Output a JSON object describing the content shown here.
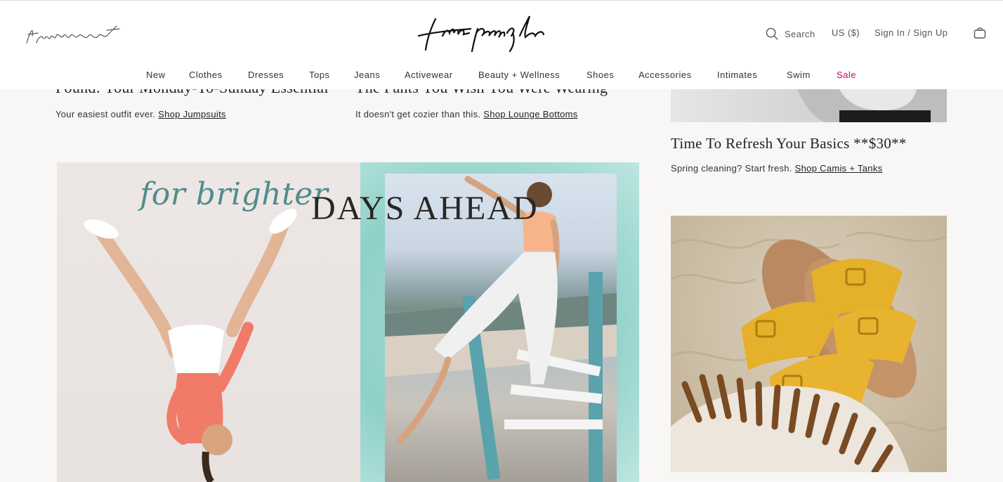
{
  "header": {
    "secondary_logo": "fpmovement",
    "brand_logo": "free people",
    "search_label": "Search",
    "currency_label": "US ($)",
    "signin_label": "Sign In / Sign Up"
  },
  "nav": {
    "items": [
      {
        "label": "New"
      },
      {
        "label": "Clothes"
      },
      {
        "label": "Dresses"
      },
      {
        "label": "Tops"
      },
      {
        "label": "Jeans"
      },
      {
        "label": "Activewear"
      },
      {
        "label": "Beauty + Wellness"
      },
      {
        "label": "Shoes"
      },
      {
        "label": "Accessories"
      },
      {
        "label": "Intimates"
      },
      {
        "label": "Swim"
      },
      {
        "label": "Sale"
      }
    ]
  },
  "promos": {
    "jumpsuits": {
      "title": "Found: Your Monday-To-Sunday Essential",
      "text": "Your easiest outfit ever.",
      "link": "Shop Jumpsuits"
    },
    "lounge": {
      "title": "The Pants You Wish You Were Wearing",
      "text": "It doesn't get cozier than this.",
      "link": "Shop Lounge Bottoms"
    },
    "basics": {
      "title": "Time To Refresh Your Basics **$30**",
      "text": "Spring cleaning? Start fresh.",
      "link": "Shop Camis + Tanks"
    }
  },
  "hero": {
    "script_text": "for brighter",
    "caps_text": "DAYS AHEAD"
  },
  "colors": {
    "accent_sale": "#d5006d",
    "hero_script": "#4f8d8c",
    "background": "#f8f7f5"
  }
}
